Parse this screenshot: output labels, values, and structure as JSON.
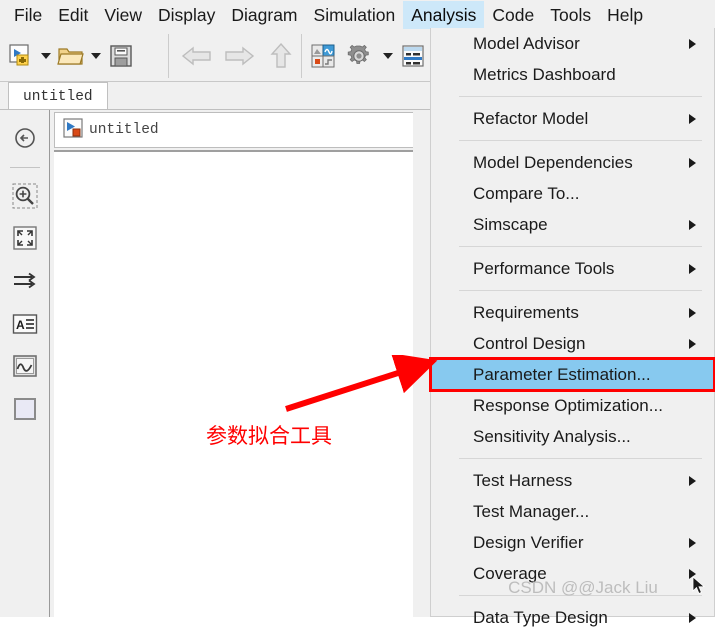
{
  "menubar": {
    "items": [
      {
        "label": "File",
        "active": false
      },
      {
        "label": "Edit",
        "active": false
      },
      {
        "label": "View",
        "active": false
      },
      {
        "label": "Display",
        "active": false
      },
      {
        "label": "Diagram",
        "active": false
      },
      {
        "label": "Simulation",
        "active": false
      },
      {
        "label": "Analysis",
        "active": true
      },
      {
        "label": "Code",
        "active": false
      },
      {
        "label": "Tools",
        "active": false
      },
      {
        "label": "Help",
        "active": false
      }
    ]
  },
  "toolbar": {
    "buttons": [
      {
        "name": "new-model-icon",
        "title": "New"
      },
      {
        "name": "new-model-dropdown-caret",
        "title": "New options"
      },
      {
        "name": "open-folder-icon",
        "title": "Open"
      },
      {
        "name": "open-dropdown-caret",
        "title": "Open options"
      },
      {
        "name": "save-icon",
        "title": "Save"
      },
      {
        "name": "back-arrow-icon",
        "title": "Back"
      },
      {
        "name": "forward-arrow-icon",
        "title": "Forward"
      },
      {
        "name": "up-arrow-icon",
        "title": "Up to parent"
      },
      {
        "name": "library-browser-icon",
        "title": "Library Browser"
      },
      {
        "name": "model-configuration-gear-icon",
        "title": "Model Configuration Parameters"
      },
      {
        "name": "model-configuration-dropdown-caret",
        "title": "Configuration options"
      },
      {
        "name": "model-explorer-icon",
        "title": "Model Explorer"
      }
    ]
  },
  "tabs": [
    {
      "label": "untitled",
      "active": true
    }
  ],
  "palette": {
    "items": [
      {
        "name": "navigate-back-icon",
        "title": "Back to parent"
      },
      {
        "name": "zoom-in-icon",
        "title": "Zoom in"
      },
      {
        "name": "fit-to-view-icon",
        "title": "Fit diagram to view"
      },
      {
        "name": "signal-routing-icon",
        "title": "Signal routing"
      },
      {
        "name": "annotation-text-icon",
        "title": "Annotation"
      },
      {
        "name": "scope-signal-icon",
        "title": "Scope"
      },
      {
        "name": "block-shape-icon",
        "title": "Block"
      }
    ]
  },
  "breadcrumb": {
    "icon": "simulink-model-icon",
    "label": "untitled"
  },
  "dropdown": {
    "owner": "Analysis",
    "items": [
      {
        "type": "item",
        "label": "Model Advisor",
        "submenu": true,
        "selected": false
      },
      {
        "type": "item",
        "label": "Metrics Dashboard",
        "submenu": false,
        "selected": false
      },
      {
        "type": "separator"
      },
      {
        "type": "item",
        "label": "Refactor Model",
        "submenu": true,
        "selected": false
      },
      {
        "type": "separator"
      },
      {
        "type": "item",
        "label": "Model Dependencies",
        "submenu": true,
        "selected": false
      },
      {
        "type": "item",
        "label": "Compare To...",
        "submenu": false,
        "selected": false
      },
      {
        "type": "item",
        "label": "Simscape",
        "submenu": true,
        "selected": false
      },
      {
        "type": "separator"
      },
      {
        "type": "item",
        "label": "Performance Tools",
        "submenu": true,
        "selected": false
      },
      {
        "type": "separator"
      },
      {
        "type": "item",
        "label": "Requirements",
        "submenu": true,
        "selected": false
      },
      {
        "type": "item",
        "label": "Control Design",
        "submenu": true,
        "selected": false
      },
      {
        "type": "item",
        "label": "Parameter Estimation...",
        "submenu": false,
        "selected": true
      },
      {
        "type": "item",
        "label": "Response Optimization...",
        "submenu": false,
        "selected": false
      },
      {
        "type": "item",
        "label": "Sensitivity Analysis...",
        "submenu": false,
        "selected": false
      },
      {
        "type": "separator"
      },
      {
        "type": "item",
        "label": "Test Harness",
        "submenu": true,
        "selected": false
      },
      {
        "type": "item",
        "label": "Test Manager...",
        "submenu": false,
        "selected": false
      },
      {
        "type": "item",
        "label": "Design Verifier",
        "submenu": true,
        "selected": false
      },
      {
        "type": "item",
        "label": "Coverage",
        "submenu": true,
        "selected": false
      },
      {
        "type": "separator"
      },
      {
        "type": "item",
        "label": "Data Type Design",
        "submenu": true,
        "selected": false
      }
    ]
  },
  "annotation": {
    "text": "参数拟合工具",
    "color": "#ff0000",
    "arrow_color": "#ff0000",
    "highlight_border_color": "#ff0000",
    "highlight_fill_color": "#87c9ef"
  },
  "watermark": {
    "text": "CSDN @@Jack Liu"
  }
}
